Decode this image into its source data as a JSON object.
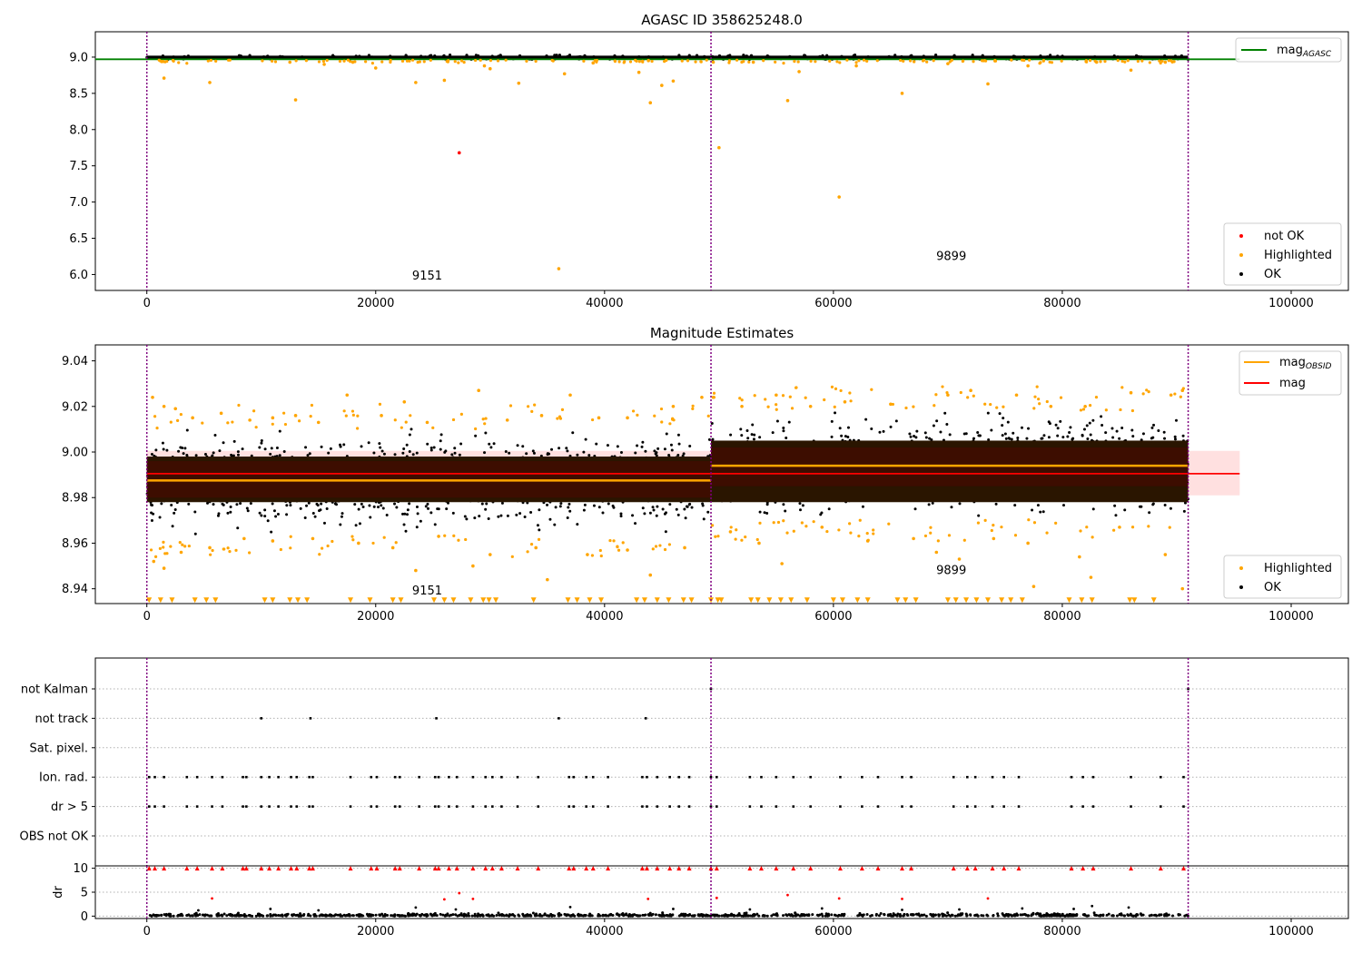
{
  "chart_data": [
    {
      "type": "scatter",
      "title": "AGASC ID 358625248.0",
      "xlim": [
        -4500,
        105000
      ],
      "ylim": [
        5.78,
        9.35
      ],
      "xticks": [
        0,
        20000,
        40000,
        60000,
        80000,
        100000
      ],
      "xtick_labels": [
        "0",
        "20000",
        "40000",
        "60000",
        "80000",
        "100000"
      ],
      "yticks": [
        6.0,
        6.5,
        7.0,
        7.5,
        8.0,
        8.5,
        9.0
      ],
      "ytick_labels": [
        "6.0",
        "6.5",
        "7.0",
        "7.5",
        "8.0",
        "8.5",
        "9.0"
      ],
      "obs_boundaries": [
        0,
        49300,
        91000
      ],
      "obs_labels": [
        {
          "text": "9151",
          "x": 24500,
          "y": 5.93
        },
        {
          "text": "9899",
          "x": 70300,
          "y": 6.2
        }
      ],
      "reference_lines": [
        {
          "name": "mag",
          "name_sub": "AGASC",
          "y": 8.97,
          "x_range": [
            -4500,
            95500
          ],
          "color": "#008000"
        }
      ],
      "ok_band": {
        "x_range": [
          0,
          91000
        ],
        "y_range": [
          8.97,
          9.02
        ],
        "color": "#000000"
      },
      "points_highlighted": [
        [
          1400,
          8.94
        ],
        [
          1500,
          8.71
        ],
        [
          5500,
          8.65
        ],
        [
          12500,
          8.93
        ],
        [
          13000,
          8.41
        ],
        [
          15500,
          8.9
        ],
        [
          18000,
          8.93
        ],
        [
          20000,
          8.85
        ],
        [
          23500,
          8.65
        ],
        [
          26000,
          8.68
        ],
        [
          29500,
          8.88
        ],
        [
          30000,
          8.84
        ],
        [
          32500,
          8.64
        ],
        [
          36000,
          6.08
        ],
        [
          36500,
          8.77
        ],
        [
          39000,
          8.92
        ],
        [
          43000,
          8.79
        ],
        [
          44000,
          8.37
        ],
        [
          45000,
          8.61
        ],
        [
          46000,
          8.67
        ],
        [
          49500,
          8.93
        ],
        [
          50000,
          7.75
        ],
        [
          53000,
          8.93
        ],
        [
          56000,
          8.4
        ],
        [
          57000,
          8.8
        ],
        [
          60500,
          7.07
        ],
        [
          62000,
          8.88
        ],
        [
          66000,
          8.5
        ],
        [
          70000,
          8.91
        ],
        [
          73500,
          8.63
        ],
        [
          77000,
          8.88
        ],
        [
          83000,
          8.93
        ],
        [
          86000,
          8.82
        ],
        [
          89000,
          8.93
        ]
      ],
      "points_not_ok": [
        [
          27300,
          7.68
        ]
      ],
      "legends": [
        {
          "position": "top-right",
          "entries": [
            {
              "label": "mag",
              "label_sub": "AGASC",
              "marker": "line",
              "color": "#008000"
            }
          ]
        },
        {
          "position": "bottom-right",
          "entries": [
            {
              "label": "not OK",
              "marker": "dot",
              "color": "#ff0000"
            },
            {
              "label": "Highlighted",
              "marker": "dot",
              "color": "#ffa500"
            },
            {
              "label": "OK",
              "marker": "dot",
              "color": "#000000"
            }
          ]
        }
      ]
    },
    {
      "type": "scatter",
      "title": "Magnitude Estimates",
      "xlim": [
        -4500,
        105000
      ],
      "ylim": [
        8.9335,
        9.047
      ],
      "xticks": [
        0,
        20000,
        40000,
        60000,
        80000,
        100000
      ],
      "xtick_labels": [
        "0",
        "20000",
        "40000",
        "60000",
        "80000",
        "100000"
      ],
      "yticks": [
        8.94,
        8.96,
        8.98,
        9.0,
        9.02,
        9.04
      ],
      "ytick_labels": [
        "8.94",
        "8.96",
        "8.98",
        "9.00",
        "9.02",
        "9.04"
      ],
      "obs_boundaries": [
        0,
        49300,
        91000
      ],
      "obs_labels": [
        {
          "text": "9151",
          "x": 24500,
          "y": 8.9375
        },
        {
          "text": "9899",
          "x": 70300,
          "y": 8.9465
        }
      ],
      "segments": [
        {
          "obsid": "9151",
          "x_range": [
            0,
            49300
          ],
          "mean": 8.9875,
          "ok_range": [
            8.964,
            9.01
          ],
          "band_inner": [
            8.98,
            8.996
          ],
          "band_outer": [
            8.978,
            8.998
          ]
        },
        {
          "obsid": "9899",
          "x_range": [
            49300,
            91000
          ],
          "mean": 8.994,
          "ok_range": [
            8.971,
            9.018
          ],
          "band_inner": [
            8.985,
            9.002
          ],
          "band_outer": [
            8.978,
            9.005
          ]
        }
      ],
      "mag_line": {
        "name": "mag",
        "y": 8.9905,
        "x_range": [
          0,
          95500
        ],
        "band": [
          8.981,
          9.0005
        ],
        "color": "#ff0000"
      },
      "obs_mag_color": "#ffa500",
      "lower_marker_y": 8.935,
      "points_highlighted": [
        [
          500,
          9.024
        ],
        [
          1500,
          9.02
        ],
        [
          2500,
          9.019
        ],
        [
          4000,
          9.015
        ],
        [
          6500,
          9.017
        ],
        [
          9000,
          9.014
        ],
        [
          11000,
          9.015
        ],
        [
          13000,
          9.016
        ],
        [
          15000,
          9.013
        ],
        [
          17500,
          9.025
        ],
        [
          20500,
          9.016
        ],
        [
          22500,
          9.022
        ],
        [
          24500,
          9.013
        ],
        [
          29000,
          9.027
        ],
        [
          31500,
          9.014
        ],
        [
          34500,
          9.016
        ],
        [
          37000,
          9.025
        ],
        [
          39500,
          9.015
        ],
        [
          42000,
          9.015
        ],
        [
          46000,
          9.02
        ],
        [
          48500,
          9.024
        ],
        [
          600,
          8.952
        ],
        [
          1500,
          8.949
        ],
        [
          3000,
          8.956
        ],
        [
          5500,
          8.958
        ],
        [
          8500,
          8.962
        ],
        [
          11000,
          8.961
        ],
        [
          14500,
          8.962
        ],
        [
          18500,
          8.96
        ],
        [
          21500,
          8.958
        ],
        [
          23500,
          8.948
        ],
        [
          25500,
          8.963
        ],
        [
          28500,
          8.95
        ],
        [
          30000,
          8.955
        ],
        [
          34000,
          8.958
        ],
        [
          35000,
          8.944
        ],
        [
          38500,
          8.955
        ],
        [
          42000,
          8.957
        ],
        [
          44000,
          8.946
        ],
        [
          47000,
          8.958
        ],
        [
          49500,
          9.024
        ],
        [
          52000,
          9.02
        ],
        [
          55000,
          9.025
        ],
        [
          58000,
          9.02
        ],
        [
          61000,
          9.022
        ],
        [
          65000,
          9.021
        ],
        [
          70000,
          9.025
        ],
        [
          72000,
          9.027
        ],
        [
          76000,
          9.025
        ],
        [
          79000,
          9.02
        ],
        [
          82000,
          9.02
        ],
        [
          86000,
          9.026
        ],
        [
          89500,
          9.025
        ],
        [
          90500,
          9.027
        ],
        [
          51000,
          8.965
        ],
        [
          53500,
          8.96
        ],
        [
          55500,
          8.951
        ],
        [
          59000,
          8.967
        ],
        [
          63000,
          8.961
        ],
        [
          67000,
          8.962
        ],
        [
          69000,
          8.956
        ],
        [
          71000,
          8.953
        ],
        [
          74000,
          8.962
        ],
        [
          77000,
          8.96
        ],
        [
          81500,
          8.954
        ],
        [
          82500,
          8.945
        ],
        [
          85000,
          8.967
        ],
        [
          89000,
          8.955
        ],
        [
          90500,
          8.94
        ],
        [
          77500,
          8.941
        ]
      ],
      "lower_marker_x": [
        200,
        1200,
        2200,
        4200,
        5200,
        6000,
        10300,
        11000,
        12500,
        13200,
        14000,
        17800,
        19500,
        21500,
        22200,
        25100,
        26000,
        26800,
        28300,
        29400,
        29900,
        30500,
        33800,
        36800,
        37600,
        38700,
        39700,
        42800,
        43500,
        44600,
        45600,
        46900,
        47600,
        49300,
        49900,
        50200,
        52800,
        53400,
        54400,
        55400,
        56300,
        57700,
        60000,
        60800,
        62100,
        63000,
        65600,
        66300,
        67200,
        70000,
        70700,
        71600,
        72500,
        73500,
        74700,
        75500,
        76500,
        80600,
        81700,
        82600,
        85900,
        86300,
        88000
      ],
      "legends": [
        {
          "position": "top-right",
          "entries": [
            {
              "label": "mag",
              "label_sub": "OBSID",
              "marker": "line",
              "color": "#ffa500"
            },
            {
              "label": "mag",
              "marker": "line",
              "color": "#ff0000"
            }
          ]
        },
        {
          "position": "bottom-right",
          "entries": [
            {
              "label": "Highlighted",
              "marker": "dot",
              "color": "#ffa500"
            },
            {
              "label": "OK",
              "marker": "dot",
              "color": "#000000"
            }
          ]
        }
      ]
    },
    {
      "type": "scatter",
      "title": "",
      "xlim": [
        -4500,
        105000
      ],
      "categories": [
        "not Kalman",
        "not track",
        "Sat. pixel.",
        "Ion. rad.",
        "dr > 5",
        "OBS not OK"
      ],
      "obs_boundaries": [
        0,
        49300,
        91000
      ],
      "flags": {
        "not Kalman": [
          49300,
          91000
        ],
        "not track": [
          10000,
          14300,
          25300,
          36000,
          43600
        ],
        "Sat. pixel.": [],
        "Ion. rad.": [
          200,
          700,
          1500,
          3500,
          4400,
          5700,
          6600,
          8400,
          8700,
          10000,
          10700,
          11500,
          12600,
          13100,
          14200,
          14500,
          17800,
          19600,
          20100,
          21700,
          22100,
          23800,
          25200,
          25500,
          26400,
          27100,
          28500,
          29600,
          30200,
          31000,
          32400,
          34200,
          36900,
          37300,
          38400,
          39000,
          40300,
          43300,
          43700,
          44600,
          45700,
          46500,
          47400,
          49300,
          49800,
          52700,
          53700,
          55000,
          56500,
          58000,
          60600,
          62500,
          63900,
          66000,
          66800,
          70500,
          71700,
          72400,
          73900,
          74900,
          76200,
          80800,
          81800,
          82700,
          86000,
          88600,
          90600
        ],
        "dr > 5": [
          200,
          700,
          1500,
          3500,
          4400,
          5700,
          6600,
          8400,
          8700,
          10000,
          10700,
          11500,
          12600,
          13100,
          14200,
          14500,
          17800,
          19600,
          20100,
          21700,
          22100,
          23800,
          25200,
          25500,
          26400,
          27100,
          28500,
          29600,
          30200,
          31000,
          32400,
          34200,
          36900,
          37300,
          38400,
          39000,
          40300,
          43300,
          43700,
          44600,
          45700,
          46500,
          47400,
          49300,
          49800,
          52700,
          53700,
          55000,
          56500,
          58000,
          60600,
          62500,
          63900,
          66000,
          66800,
          70500,
          71700,
          72400,
          73900,
          74900,
          76200,
          80800,
          81800,
          82700,
          86000,
          88600,
          90600
        ],
        "OBS not OK": []
      }
    },
    {
      "type": "scatter",
      "title": "",
      "xlim": [
        -4500,
        105000
      ],
      "ylim": [
        -0.5,
        10.5
      ],
      "yticks": [
        0,
        5,
        10
      ],
      "ytick_labels": [
        "0",
        "5",
        "10"
      ],
      "xticks": [
        0,
        20000,
        40000,
        60000,
        80000,
        100000
      ],
      "xtick_labels": [
        "0",
        "20000",
        "40000",
        "60000",
        "80000",
        "100000"
      ],
      "ylabel": "dr",
      "obs_boundaries": [
        0,
        49300,
        91000
      ],
      "clipped_y": 10,
      "points_clipped": [
        200,
        700,
        1500,
        3500,
        4400,
        5700,
        6600,
        8400,
        8700,
        10000,
        10700,
        11500,
        12600,
        13100,
        14200,
        14500,
        17800,
        19600,
        20100,
        21700,
        22100,
        23800,
        25200,
        25500,
        26400,
        27100,
        28500,
        29600,
        30200,
        31000,
        32400,
        34200,
        36900,
        37300,
        38400,
        39000,
        40300,
        43300,
        43700,
        44600,
        45700,
        46500,
        47400,
        49300,
        49800,
        52700,
        53700,
        55000,
        56500,
        58000,
        60600,
        62500,
        63900,
        66000,
        66800,
        70500,
        71700,
        72400,
        73900,
        74900,
        76200,
        80800,
        81800,
        82700,
        86000,
        88600,
        90600
      ],
      "points_high": [
        [
          5700,
          3.7
        ],
        [
          26000,
          3.5
        ],
        [
          27300,
          4.8
        ],
        [
          28500,
          3.6
        ],
        [
          43800,
          3.6
        ],
        [
          49800,
          3.8
        ],
        [
          56000,
          4.4
        ],
        [
          60500,
          3.7
        ],
        [
          66000,
          3.6
        ],
        [
          73500,
          3.7
        ]
      ],
      "points_mid": [
        [
          4500,
          1.2
        ],
        [
          10800,
          1.5
        ],
        [
          15000,
          1.2
        ],
        [
          23500,
          1.8
        ],
        [
          27000,
          1.4
        ],
        [
          37000,
          1.9
        ],
        [
          46000,
          1.5
        ],
        [
          52700,
          1.4
        ],
        [
          59000,
          1.6
        ],
        [
          66000,
          1.3
        ],
        [
          71000,
          1.4
        ],
        [
          76500,
          1.6
        ],
        [
          81000,
          1.5
        ],
        [
          82600,
          2.1
        ],
        [
          85800,
          1.8
        ]
      ]
    }
  ]
}
